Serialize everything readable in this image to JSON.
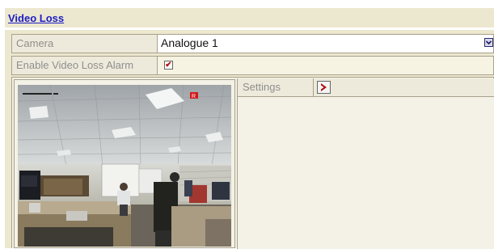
{
  "header": {
    "title": "Video Loss"
  },
  "form": {
    "camera_label": "Camera",
    "camera_value": "Analogue 1",
    "alarm_label": "Enable Video Loss Alarm",
    "alarm_checked": true,
    "checkbox_mark": "✔"
  },
  "settings": {
    "label": "Settings"
  },
  "preview": {
    "recording_badge": "R"
  },
  "colors": {
    "accent_link": "#1c1cc4",
    "panel_bg": "#ece7cf",
    "arrow": "#b01010"
  },
  "icons": [
    "chevron-down-icon",
    "checkmark-icon",
    "chevron-right-icon",
    "record-badge-icon"
  ]
}
